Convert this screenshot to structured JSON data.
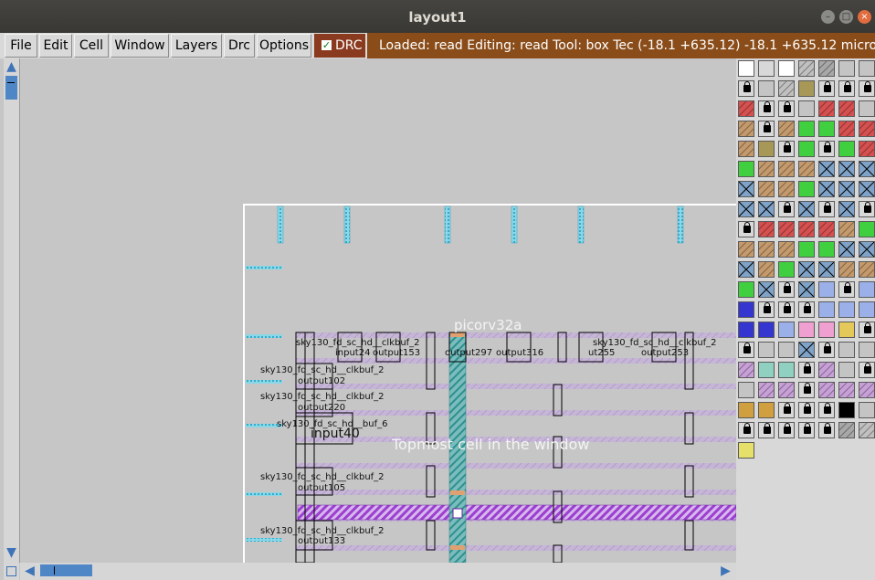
{
  "window": {
    "title": "layout1"
  },
  "menu": [
    "File",
    "Edit",
    "Cell",
    "Window",
    "Layers",
    "Drc",
    "Options"
  ],
  "drc": {
    "label": "DRC",
    "checked": true
  },
  "status": {
    "text": "Loaded: read Editing: read Tool: box  Tec     (-18.1 +635.12) -18.1 +635.12 microns"
  },
  "canvas": {
    "top_cell": "picorv32a",
    "hint": "Topmost cell in the window",
    "top_row_labels": [
      "sky130_fd_sc_hd__clkbuf_2",
      "input24",
      "output153",
      "output297",
      "output316",
      "ut255",
      "output253",
      "sky130_fd_sc_hd__clkbuf_2"
    ],
    "cell_rows": [
      {
        "cell": "sky130_fd_sc_hd__clkbuf_2",
        "inst": "output102"
      },
      {
        "cell": "sky130_fd_sc_hd__clkbuf_2",
        "inst": "output220"
      },
      {
        "cell": "sky130_fd_sc_hd__buf_6",
        "inst": "input40"
      },
      {
        "cell": "sky130_fd_sc_hd__clkbuf_2",
        "inst": "output105"
      },
      {
        "cell": "sky130_fd_sc_hd__clkbuf_2",
        "inst": "output133"
      }
    ]
  },
  "palette_colors": {
    "green": "#3fcf3f",
    "red": "#d65050",
    "tan": "#c49a6c",
    "blue_x": "#7fa3c8",
    "purple": "#9b3fd0"
  }
}
